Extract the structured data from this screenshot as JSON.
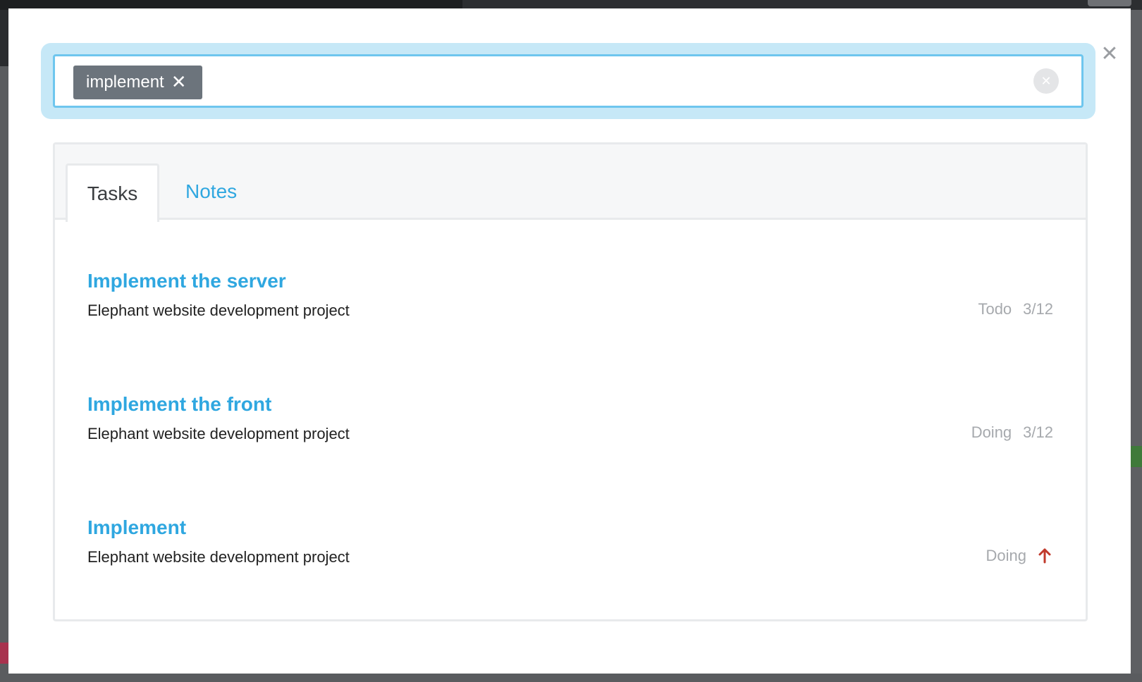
{
  "search": {
    "chip_label": "implement",
    "chip_remove_icon": "close-icon",
    "clear_icon": "clear-circle-icon"
  },
  "modal": {
    "close_icon": "close-icon"
  },
  "tabs": [
    {
      "label": "Tasks",
      "active": true
    },
    {
      "label": "Notes",
      "active": false
    }
  ],
  "results": [
    {
      "title": "Implement the server",
      "project": "Elephant website development project",
      "status": "Todo",
      "count": "3/12"
    },
    {
      "title": "Implement the front",
      "project": "Elephant website development project",
      "status": "Doing",
      "count": "3/12"
    },
    {
      "title": "Implement",
      "project": "Elephant website development project",
      "status": "Doing",
      "priority_icon": "arrow-up-icon",
      "priority_color": "#c0392b"
    }
  ],
  "colors": {
    "accent": "#2fa7e0",
    "chip_bg": "#6c747c",
    "search_halo": "#c6e8f7",
    "muted": "#a6a9ad"
  }
}
